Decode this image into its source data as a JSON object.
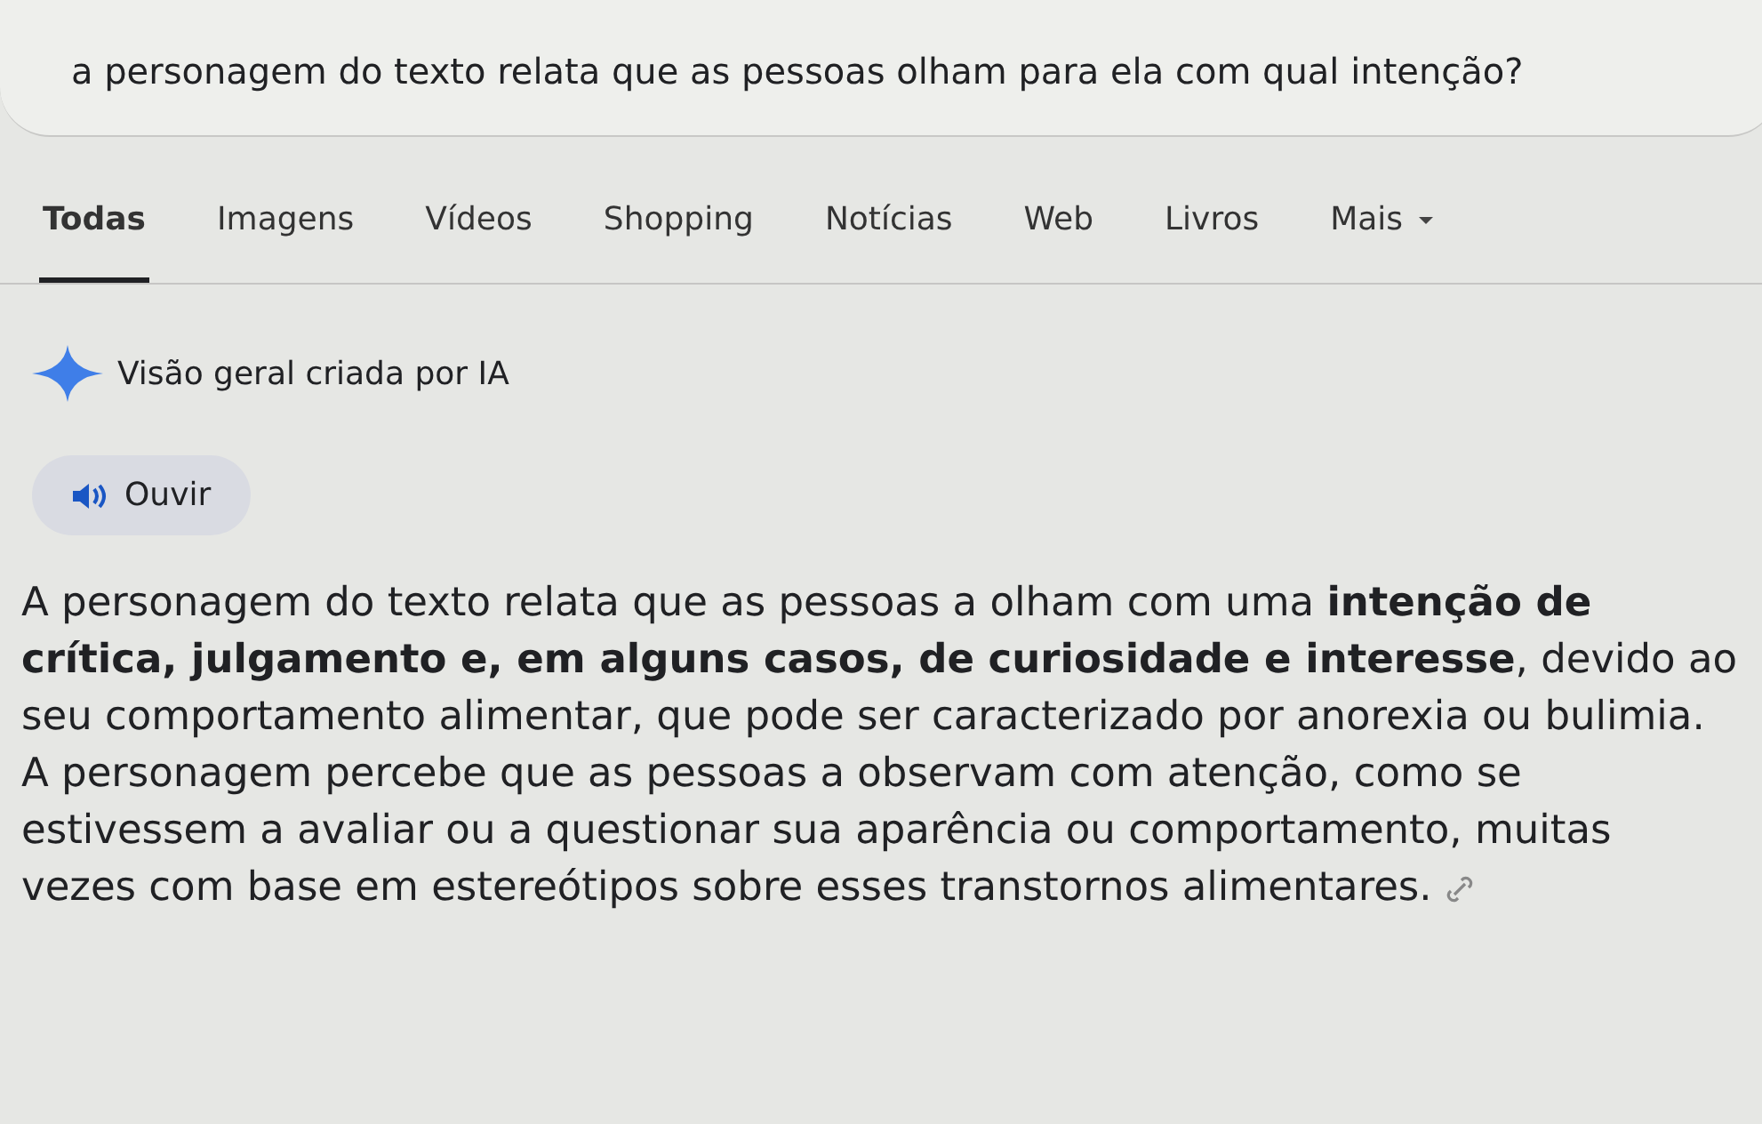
{
  "search": {
    "value": "a personagem do texto relata que as pessoas olham para ela com qual intenção?"
  },
  "tabs": [
    {
      "label": "Todas",
      "selected": true
    },
    {
      "label": "Imagens",
      "selected": false
    },
    {
      "label": "Vídeos",
      "selected": false
    },
    {
      "label": "Shopping",
      "selected": false
    },
    {
      "label": "Notícias",
      "selected": false
    },
    {
      "label": "Web",
      "selected": false
    },
    {
      "label": "Livros",
      "selected": false
    },
    {
      "label": "Mais",
      "selected": false,
      "kind": "menu"
    }
  ],
  "ai_overview": {
    "title": "Visão geral criada por IA",
    "listen_button": "Ouvir",
    "answer": "A personagem do texto relata que as pessoas a olham com uma **intenção de crítica, julgamento e, em alguns casos, de curiosidade e interesse**, devido ao seu comportamento alimentar, que pode ser caracterizado por anorexia ou bulimia. A personagem percebe que as pessoas a observam com atenção, como se estivessem a avaliar ou a questionar sua aparência ou comportamento, muitas vezes com base em estereótipos sobre esses transtornos alimentares."
  }
}
